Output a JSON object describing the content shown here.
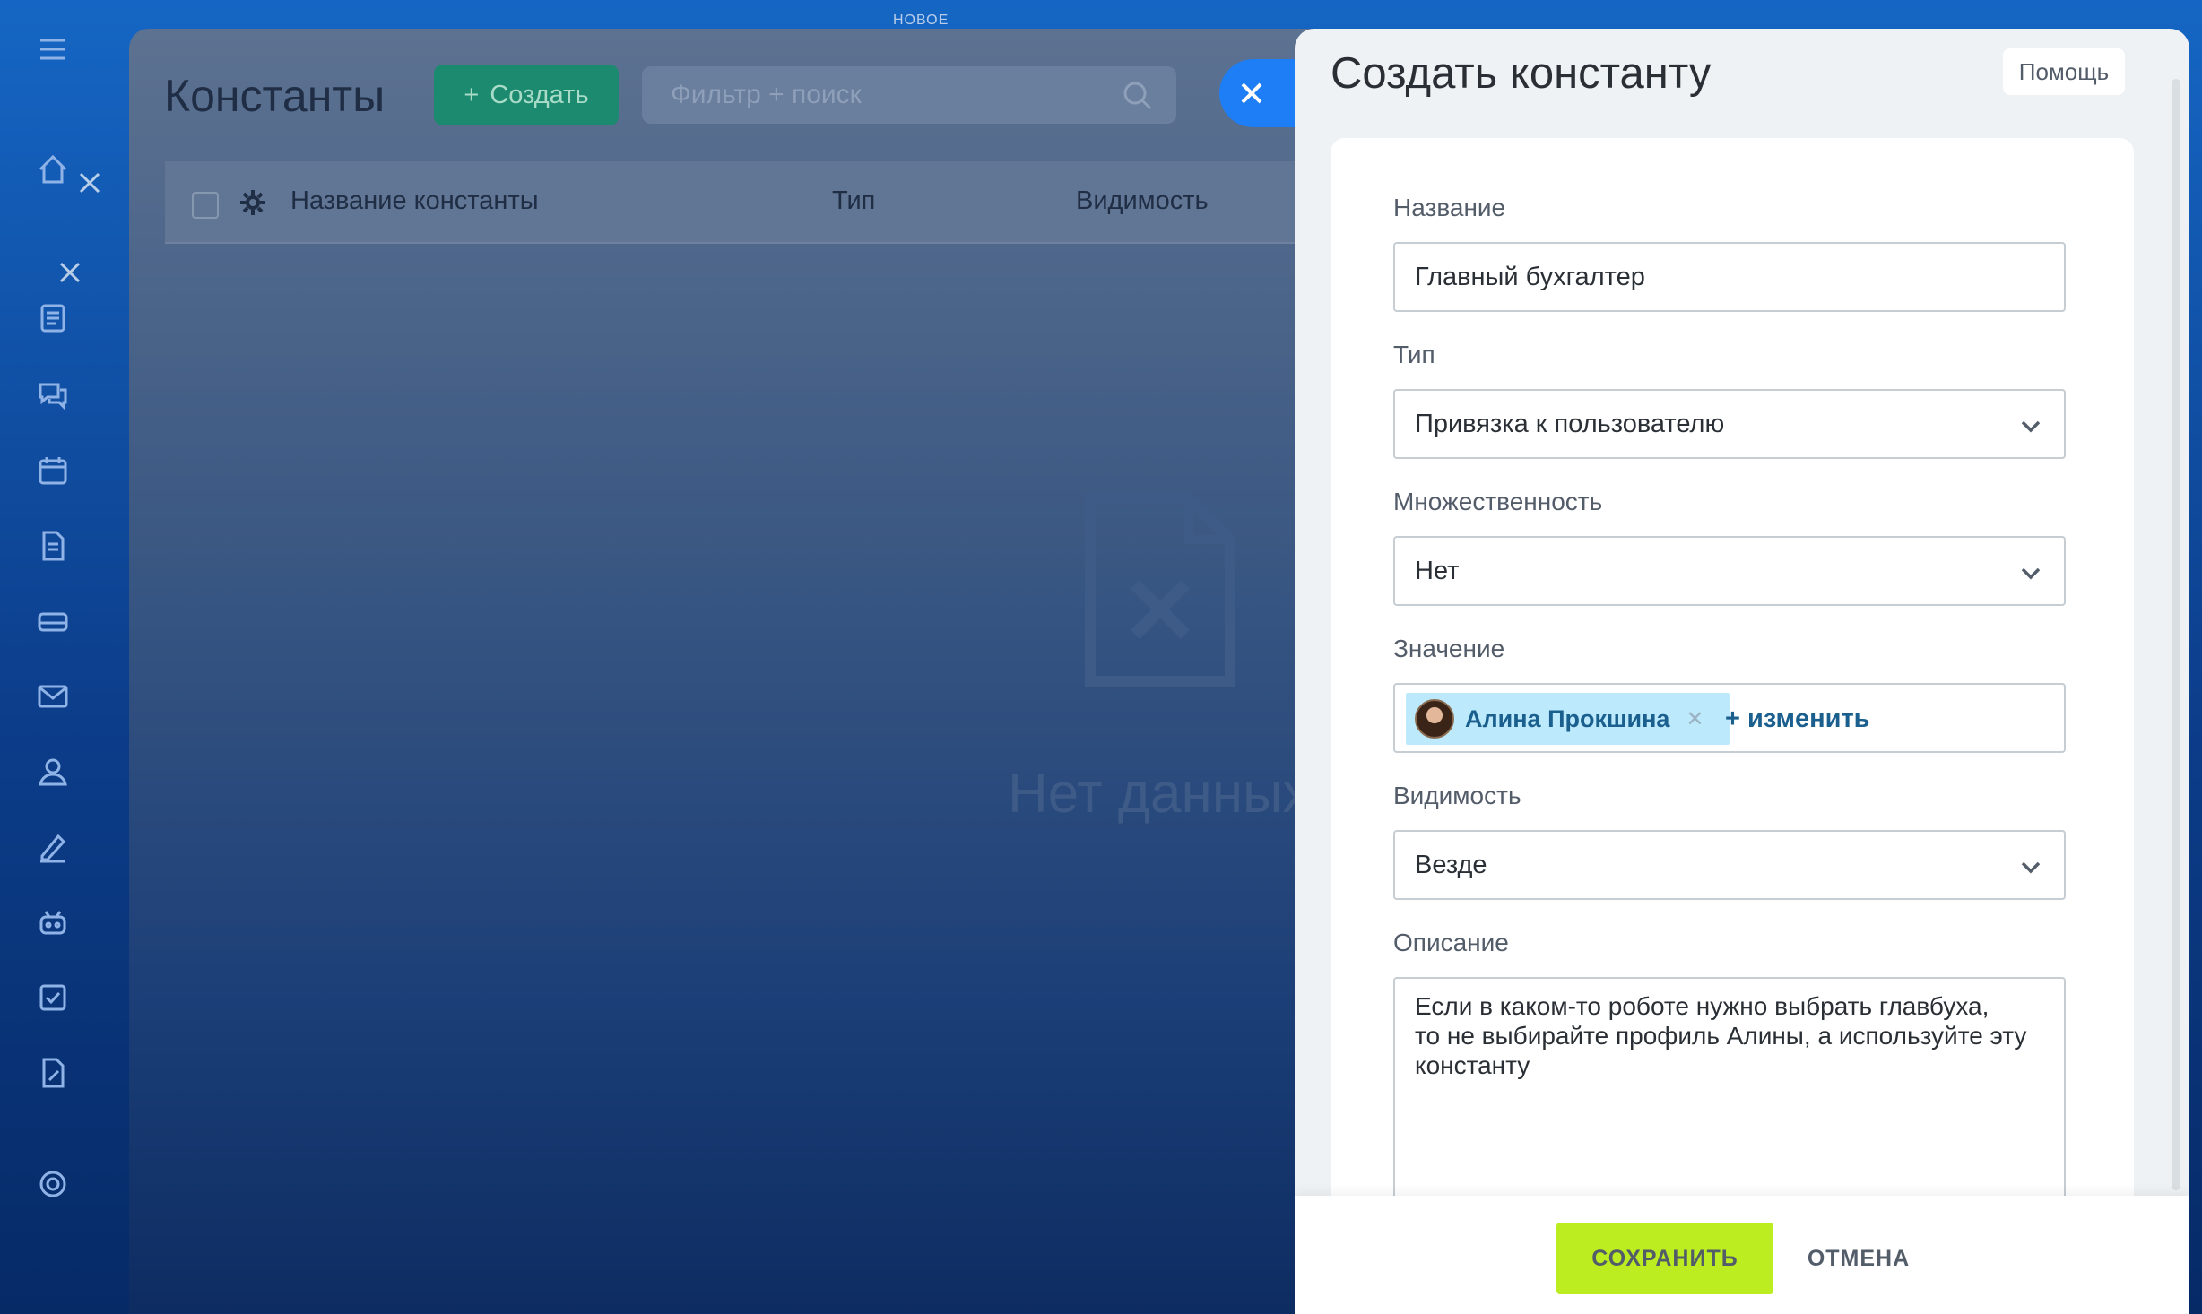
{
  "top_badge": "НОВОЕ",
  "background_page": {
    "title": "Константы",
    "create_button_label": "Создать",
    "search_placeholder": "Фильтр + поиск",
    "columns": [
      "Название константы",
      "Тип",
      "Видимость"
    ],
    "empty_text": "Нет данных"
  },
  "panel": {
    "title": "Создать константу",
    "help_label": "Помощь",
    "fields": {
      "name": {
        "label": "Название",
        "value": "Главный бухгалтер"
      },
      "type": {
        "label": "Тип",
        "value": "Привязка к пользователю"
      },
      "multiple": {
        "label": "Множественность",
        "value": "Нет"
      },
      "value": {
        "label": "Значение",
        "user": "Алина Прокшина",
        "change_link": "+ изменить"
      },
      "visibility": {
        "label": "Видимость",
        "value": "Везде"
      },
      "description": {
        "label": "Описание",
        "value": "Если в каком-то роботе нужно выбрать главбуха,\nто не выбирайте профиль Алины, а используйте эту\nконстанту"
      }
    },
    "save_label": "СОХРАНИТЬ",
    "cancel_label": "ОТМЕНА"
  },
  "left_nav_icons": [
    "menu-icon",
    "home-icon",
    "feed-icon",
    "chat-icon",
    "calendar-icon",
    "document-icon",
    "drive-icon",
    "mail-icon",
    "contacts-icon",
    "sign-icon",
    "robot-icon",
    "tasks-icon",
    "docs-edit-icon",
    "settings-icon"
  ],
  "colors": {
    "accent_blue": "#1e7ef5",
    "save_green": "#bbed21",
    "create_green": "#1c8a6e",
    "chip_bg": "#bce9fb"
  }
}
